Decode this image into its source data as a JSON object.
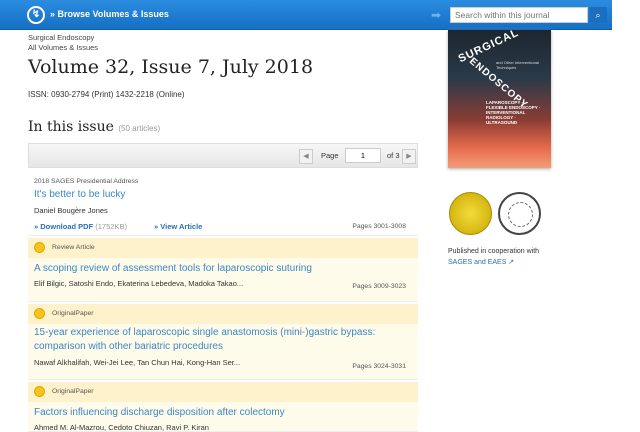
{
  "header": {
    "logo": "springer-logo",
    "browse_label": "» Browse Volumes & Issues",
    "search_placeholder": "Search within this journal",
    "search_icon": "🔍"
  },
  "breadcrumb": [
    "Surgical Endoscopy",
    "All Volumes & Issues"
  ],
  "title": "Volume 32, Issue 7, July 2018",
  "issn": "ISSN: 0930-2794 (Print) 1432-2218 (Online)",
  "issue": {
    "heading": "In this issue",
    "count": "(50 articles)"
  },
  "pager": {
    "prev": "◀",
    "label": "Page",
    "value": "1",
    "of": "of 3",
    "next": "▶"
  },
  "articles": [
    {
      "type": "2018 SAGES Presidential Address",
      "title": "It's better to be lucky",
      "authors": "Daniel Bougère Jones",
      "download": "» Download PDF",
      "size": "(1752KB)",
      "view": "» View Article",
      "pages": "Pages 3001-3008"
    },
    {
      "type": "Review Article",
      "title": "A scoping review of assessment tools for laparoscopic suturing",
      "authors": "Elif Bilgic, Satoshi Endo, Ekaterina Lebedeva, Madoka Takao...",
      "pages": "Pages 3009-3023"
    },
    {
      "type": "OriginalPaper",
      "title": "15-year experience of laparoscopic single anastomosis (mini-)gastric bypass: comparison with other bariatric procedures",
      "authors": "Nawaf Alkhalifah, Wei-Jei Lee, Tan Chun Hai, Kong-Han Ser...",
      "pages": "Pages 3024-3031"
    },
    {
      "type": "OriginalPaper",
      "title": "Factors influencing discharge disposition after colectomy",
      "authors": "Ahmed M. Al-Mazrou, Cedoto Chiuzan, Ravi P. Kiran"
    }
  ],
  "sidebar": {
    "cover_title_1": "SURGICAL",
    "cover_title_2": "ENDOSCOPY",
    "cover_sub": "and Other Interventional Techniques",
    "cover_topics": "LAPAROSCOPY · FLEXIBLE ENDOSCOPY · INTERVENTIONAL RADIOLOGY · ULTRASOUND",
    "published": "Published in cooperation with",
    "partners": "SAGES and EAES ↗"
  }
}
